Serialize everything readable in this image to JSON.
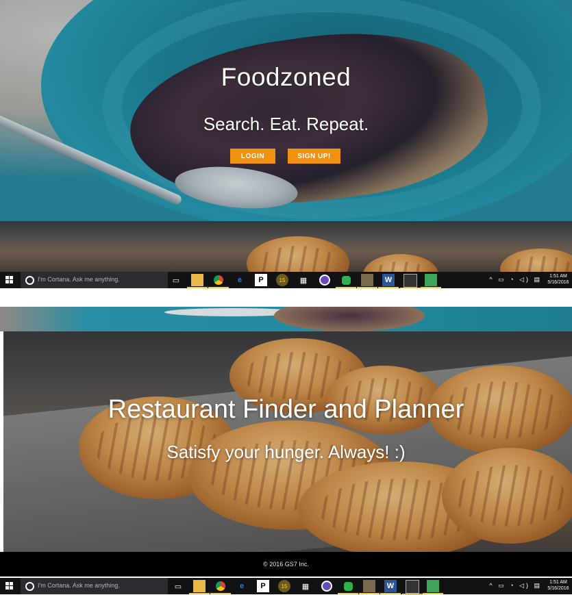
{
  "site": {
    "brand": "Foodzoned",
    "tagline": "Search. Eat. Repeat.",
    "buttons": {
      "login": "LOGIN",
      "signup": "SIGN UP!"
    },
    "accent": "#f0920e"
  },
  "feature": {
    "title": "Restaurant Finder and Planner",
    "subtitle": "Satisfy your hunger. Always! :)"
  },
  "footer": {
    "text": "© 2016 GS7 Inc."
  },
  "taskbar": {
    "search_placeholder": "I'm Cortana. Ask me anything.",
    "apps": [
      "task-view-icon",
      "file-explorer-icon",
      "chrome-icon",
      "edge-icon",
      "p-app-icon",
      "app-15-icon",
      "store-icon",
      "purple-app-icon",
      "green-app-icon",
      "photo-app-icon",
      "word-icon",
      "terminal-icon",
      "green-box-icon"
    ],
    "time": "1:51 AM",
    "date": "5/16/2016"
  }
}
